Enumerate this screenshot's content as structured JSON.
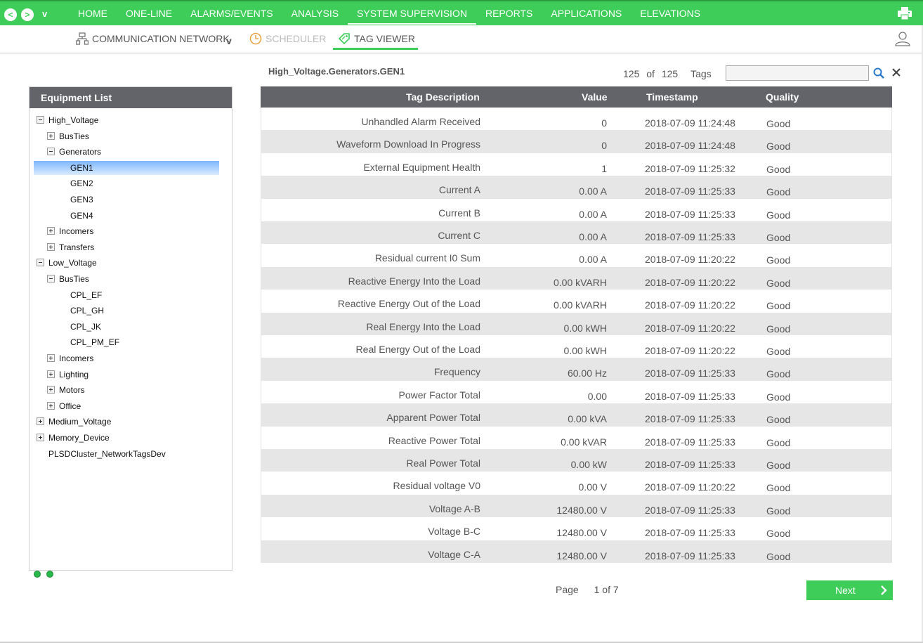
{
  "topnav": {
    "back_label": "<",
    "forward_label": ">",
    "caret": "v",
    "items": [
      "HOME",
      "ONE-LINE",
      "ALARMS/EVENTS",
      "ANALYSIS",
      "SYSTEM SUPERVISION",
      "REPORTS",
      "APPLICATIONS",
      "ELEVATIONS"
    ],
    "active": "SYSTEM SUPERVISION"
  },
  "subnav": {
    "communication_network": "COMMUNICATION NETWORK",
    "caret": "v",
    "scheduler": "SCHEDULER",
    "tag_viewer": "TAG VIEWER"
  },
  "equipment": {
    "title": "Equipment List",
    "tree": [
      {
        "label": "High_Voltage",
        "level": 0,
        "toggle": "minus"
      },
      {
        "label": "BusTies",
        "level": 1,
        "toggle": "plus"
      },
      {
        "label": "Generators",
        "level": 1,
        "toggle": "minus"
      },
      {
        "label": "GEN1",
        "level": 2,
        "toggle": "none",
        "selected": true
      },
      {
        "label": "GEN2",
        "level": 2,
        "toggle": "none"
      },
      {
        "label": "GEN3",
        "level": 2,
        "toggle": "none"
      },
      {
        "label": "GEN4",
        "level": 2,
        "toggle": "none"
      },
      {
        "label": "Incomers",
        "level": 1,
        "toggle": "plus"
      },
      {
        "label": "Transfers",
        "level": 1,
        "toggle": "plus"
      },
      {
        "label": "Low_Voltage",
        "level": 0,
        "toggle": "minus"
      },
      {
        "label": "BusTies",
        "level": 1,
        "toggle": "minus"
      },
      {
        "label": "CPL_EF",
        "level": 2,
        "toggle": "none"
      },
      {
        "label": "CPL_GH",
        "level": 2,
        "toggle": "none"
      },
      {
        "label": "CPL_JK",
        "level": 2,
        "toggle": "none"
      },
      {
        "label": "CPL_PM_EF",
        "level": 2,
        "toggle": "none"
      },
      {
        "label": "Incomers",
        "level": 1,
        "toggle": "plus"
      },
      {
        "label": "Lighting",
        "level": 1,
        "toggle": "plus"
      },
      {
        "label": "Motors",
        "level": 1,
        "toggle": "plus"
      },
      {
        "label": "Office",
        "level": 1,
        "toggle": "plus"
      },
      {
        "label": "Medium_Voltage",
        "level": 0,
        "toggle": "plus"
      },
      {
        "label": "Memory_Device",
        "level": 0,
        "toggle": "plus"
      },
      {
        "label": "PLSDCluster_NetworkTagsDev",
        "level": 0,
        "toggle": "none"
      }
    ]
  },
  "tags": {
    "path": "High_Voltage.Generators.GEN1",
    "count_shown": "125",
    "count_of": "of",
    "count_total": "125",
    "count_unit": "Tags",
    "search_value": "",
    "columns": [
      "Tag Description",
      "Value",
      "Timestamp",
      "Quality"
    ],
    "rows": [
      [
        "Unhandled Alarm Received",
        "0",
        "2018-07-09 11:24:48",
        "Good"
      ],
      [
        "Waveform Download In Progress",
        "0",
        "2018-07-09 11:24:48",
        "Good"
      ],
      [
        "External Equipment Health",
        "1",
        "2018-07-09 11:25:32",
        "Good"
      ],
      [
        "Current A",
        "0.00 A",
        "2018-07-09 11:25:33",
        "Good"
      ],
      [
        "Current B",
        "0.00 A",
        "2018-07-09 11:25:33",
        "Good"
      ],
      [
        "Current C",
        "0.00 A",
        "2018-07-09 11:25:33",
        "Good"
      ],
      [
        "Residual current I0 Sum",
        "0.00 A",
        "2018-07-09 11:20:22",
        "Good"
      ],
      [
        "Reactive Energy Into the Load",
        "0.00 kVARH",
        "2018-07-09 11:20:22",
        "Good"
      ],
      [
        "Reactive Energy Out of the Load",
        "0.00 kVARH",
        "2018-07-09 11:20:22",
        "Good"
      ],
      [
        "Real Energy Into the Load",
        "0.00 kWH",
        "2018-07-09 11:20:22",
        "Good"
      ],
      [
        "Real Energy Out of the Load",
        "0.00 kWH",
        "2018-07-09 11:20:22",
        "Good"
      ],
      [
        "Frequency",
        "60.00 Hz",
        "2018-07-09 11:25:33",
        "Good"
      ],
      [
        "Power Factor Total",
        "0.00",
        "2018-07-09 11:25:33",
        "Good"
      ],
      [
        "Apparent Power Total",
        "0.00 kVA",
        "2018-07-09 11:25:33",
        "Good"
      ],
      [
        "Reactive Power Total",
        "0.00 kVAR",
        "2018-07-09 11:25:33",
        "Good"
      ],
      [
        "Real Power Total",
        "0.00 kW",
        "2018-07-09 11:25:33",
        "Good"
      ],
      [
        "Residual voltage V0",
        "0.00 V",
        "2018-07-09 11:20:22",
        "Good"
      ],
      [
        "Voltage A-B",
        "12480.00 V",
        "2018-07-09 11:25:33",
        "Good"
      ],
      [
        "Voltage B-C",
        "12480.00 V",
        "2018-07-09 11:25:33",
        "Good"
      ],
      [
        "Voltage C-A",
        "12480.00 V",
        "2018-07-09 11:25:33",
        "Good"
      ]
    ]
  },
  "pager": {
    "page_label": "Page",
    "current": "1",
    "of": "of",
    "total": "7",
    "next_label": "Next"
  },
  "colors": {
    "brand_green": "#3dcd58",
    "header_gray": "#626469",
    "row_alt": "#e6e6e6"
  }
}
